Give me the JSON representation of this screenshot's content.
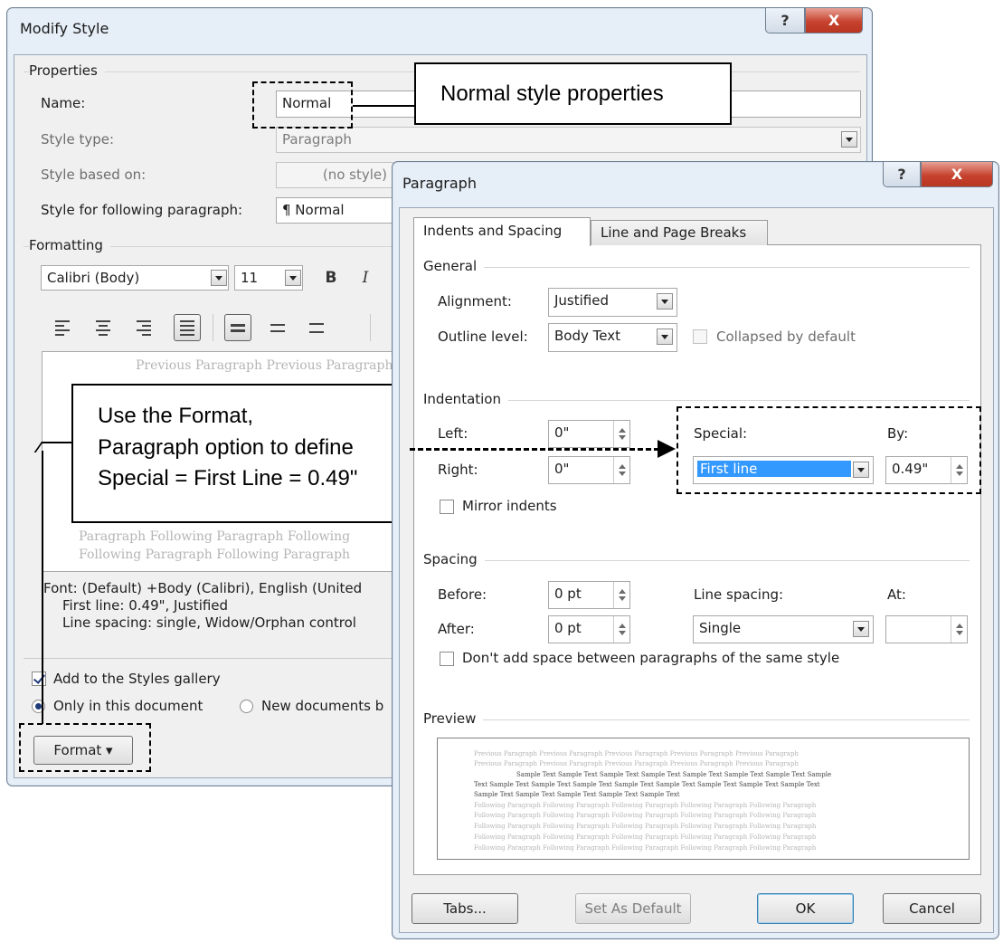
{
  "modify": {
    "title": "Modify Style",
    "help": "?",
    "close": "X",
    "properties_heading": "Properties",
    "name_label": "Name:",
    "name_value": "Normal",
    "style_type_label": "Style type:",
    "style_type_value": "Paragraph",
    "based_on_label": "Style based on:",
    "based_on_value": "(no style)",
    "following_label": "Style for following paragraph:",
    "following_value": "¶  Normal",
    "formatting_heading": "Formatting",
    "font_value": "Calibri (Body)",
    "size_value": "11",
    "bold": "B",
    "italic": "I",
    "preview_lines": [
      "Previous  Paragraph  Previous  Paragraph",
      "Paragraph  Following  Paragraph  Following",
      "Following  Paragraph  Following  Paragraph"
    ],
    "description_lines": [
      "Font: (Default) +Body (Calibri), English (United",
      "First line:  0.49\", Justified",
      "Line spacing:  single, Widow/Orphan control"
    ],
    "add_gallery": "Add to the Styles gallery",
    "only_doc": "Only in this document",
    "new_docs": "New documents b",
    "format_button": "Format ▾"
  },
  "para": {
    "title": "Paragraph",
    "help": "?",
    "close": "X",
    "tabs": [
      "Indents and Spacing",
      "Line and Page Breaks"
    ],
    "general_heading": "General",
    "alignment_label": "Alignment:",
    "alignment_value": "Justified",
    "outline_label": "Outline level:",
    "outline_value": "Body Text",
    "collapsed_label": "Collapsed by default",
    "indentation_heading": "Indentation",
    "left_label": "Left:",
    "left_value": "0\"",
    "right_label": "Right:",
    "right_value": "0\"",
    "special_label": "Special:",
    "special_value": "First line",
    "by_label": "By:",
    "by_value": "0.49\"",
    "mirror_label": "Mirror indents",
    "spacing_heading": "Spacing",
    "before_label": "Before:",
    "before_value": "0 pt",
    "after_label": "After:",
    "after_value": "0 pt",
    "line_spacing_label": "Line spacing:",
    "line_spacing_value": "Single",
    "at_label": "At:",
    "at_value": "",
    "dont_add_label": "Don't add space between paragraphs of the same style",
    "preview_heading": "Preview",
    "preview_lines": [
      "Previous Paragraph Previous Paragraph Previous Paragraph Previous Paragraph Previous Paragraph",
      "Previous Paragraph Previous Paragraph Previous Paragraph Previous Paragraph Previous Paragraph",
      "Sample Text Sample Text Sample Text Sample Text Sample Text Sample Text Sample Text Sample",
      "Text Sample Text Sample Text Sample Text Sample Text Sample Text Sample Text Sample Text Sample Text",
      "Sample Text Sample Text Sample Text Sample Text Sample Text",
      "Following Paragraph Following Paragraph Following Paragraph Following Paragraph Following Paragraph",
      "Following Paragraph Following Paragraph Following Paragraph Following Paragraph Following Paragraph",
      "Following Paragraph Following Paragraph Following Paragraph Following Paragraph Following Paragraph"
    ],
    "tabs_button": "Tabs...",
    "default_button": "Set As Default",
    "ok_button": "OK",
    "cancel_button": "Cancel"
  },
  "callouts": {
    "normal_props": "Normal style properties",
    "use_format": [
      "Use the Format,",
      "Paragraph option to define",
      "Special = First Line = 0.49\""
    ]
  }
}
